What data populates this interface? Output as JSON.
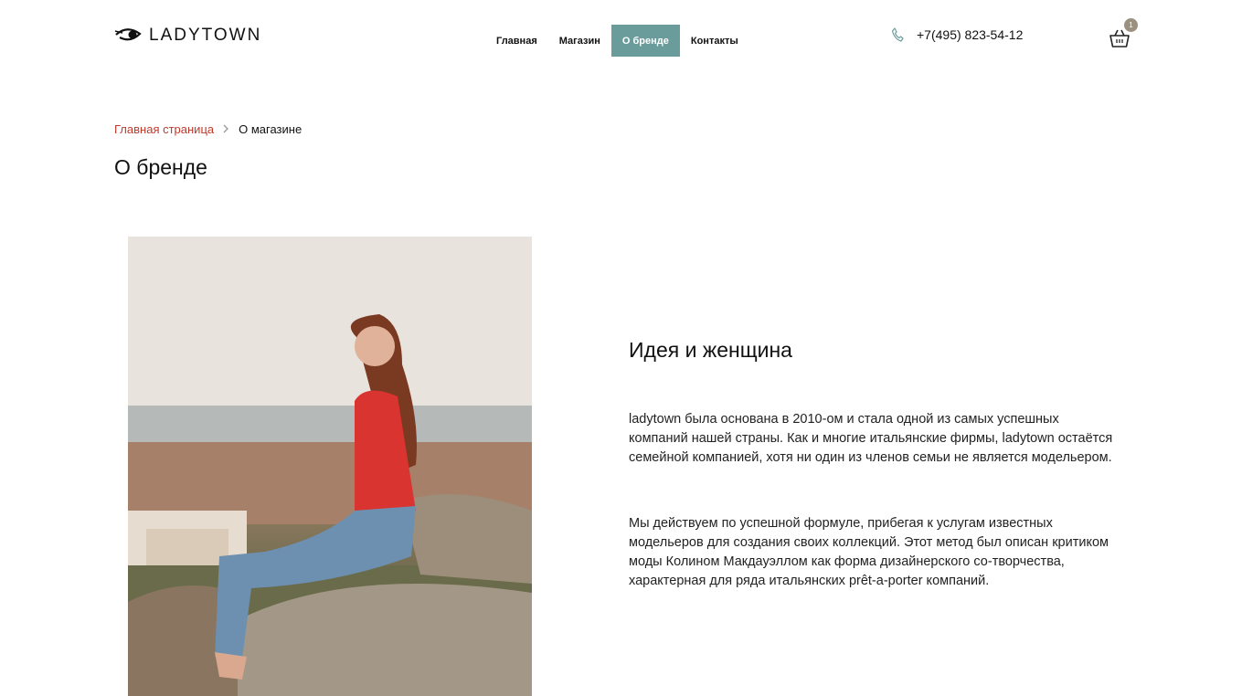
{
  "header": {
    "logo_text": "LADYTOWN",
    "nav": [
      {
        "label": "Главная",
        "active": false
      },
      {
        "label": "Магазин",
        "active": false
      },
      {
        "label": "О бренде",
        "active": true
      },
      {
        "label": "Контакты",
        "active": false
      }
    ],
    "phone": "+7(495) 823-54-12",
    "cart_count": "1",
    "accent_color": "#6b9c9c"
  },
  "breadcrumb": {
    "home": "Главная страница",
    "separator_icon": "chevron-right-icon",
    "current": "О магазине"
  },
  "page_title": "О бренде",
  "article": {
    "title": "Идея и женщина",
    "paragraphs": [
      "ladytown была основана в 2010-ом и стала одной из самых успешных компаний нашей страны. Как и многие итальянские фирмы, ladytown остаётся семейной компанией, хотя ни один из членов семьи не является модельером.",
      "Мы действуем по успешной формуле, прибегая к услугам известных модельеров для создания своих коллекций. Этот метод был описан критиком моды Колином Макдауэллом как форма дизайнерского со-творчества, характерная для ряда итальянских prêt-a-porter компаний."
    ]
  }
}
